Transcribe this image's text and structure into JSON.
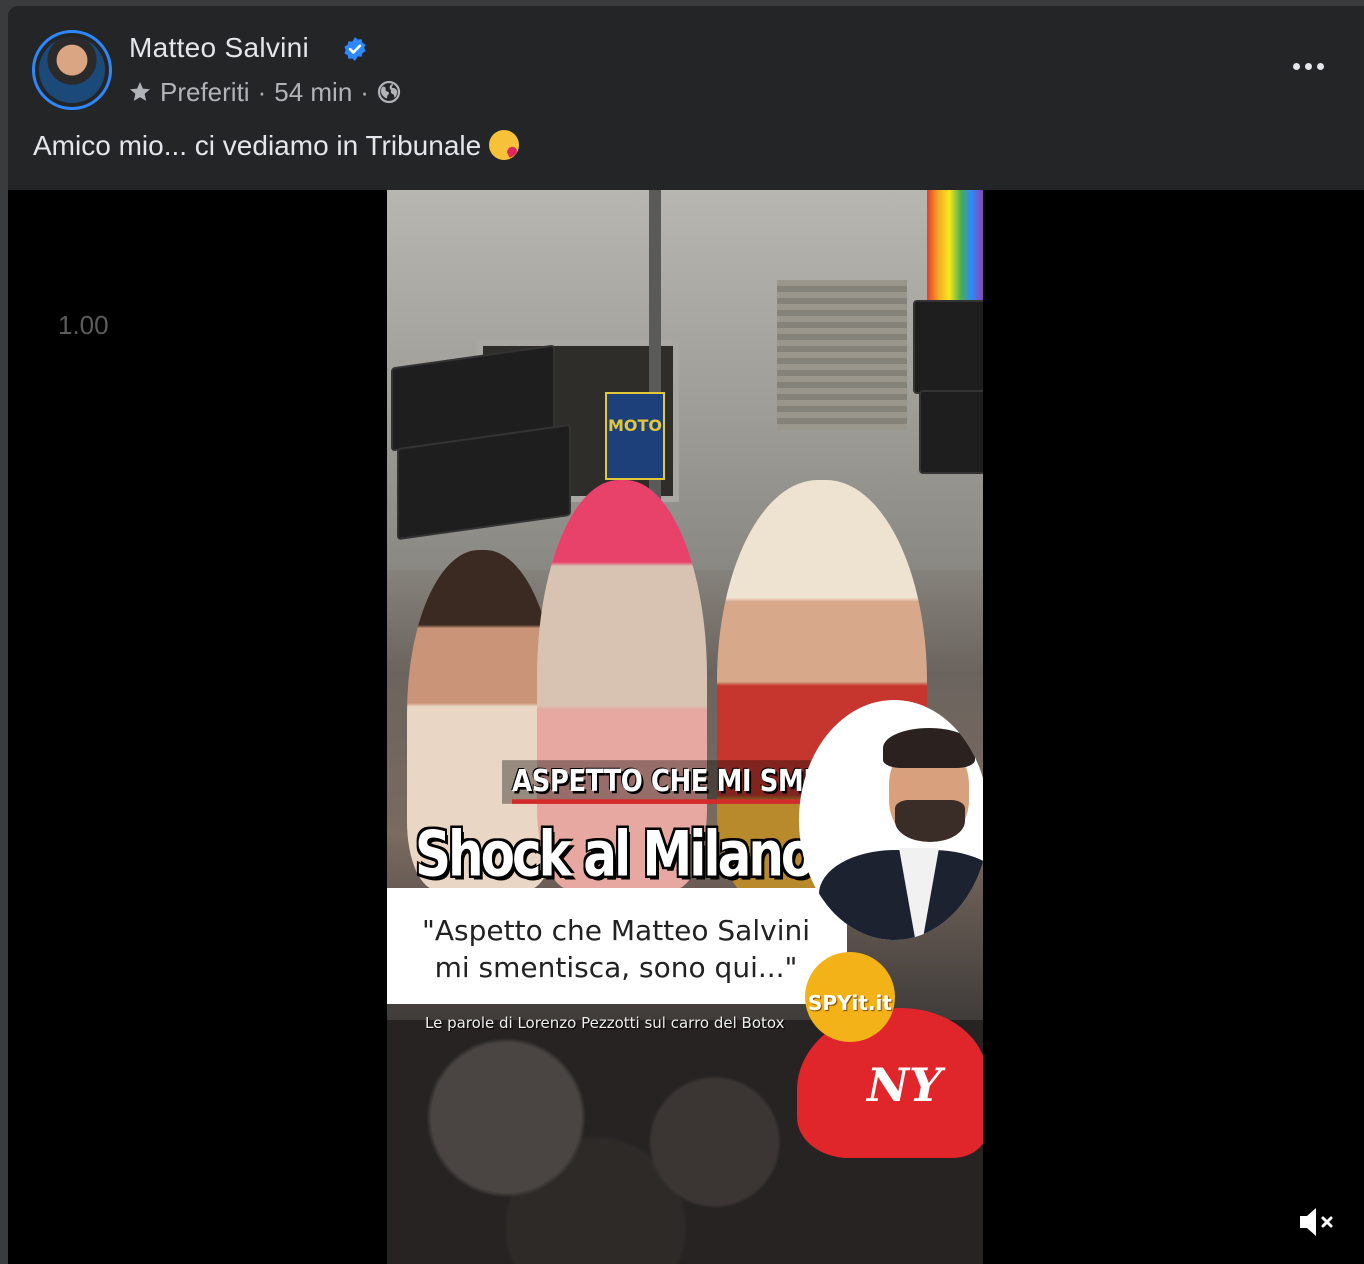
{
  "post": {
    "author": "Matteo Salvini",
    "verified": true,
    "audience_label": "Preferiti",
    "separator": "·",
    "time": "54 min",
    "caption": "Amico mio... ci vediamo in Tribunale",
    "caption_emoji": "kissing-face-emoji"
  },
  "video": {
    "speed": "1.00",
    "muted": true,
    "overlay": {
      "headline_small": "ASPETTO CHE MI SMENTISCA",
      "headline_big": "Shock al Milano Pride",
      "quote_line1": "\"Aspetto che Matteo Salvini",
      "quote_line2": "mi smentisca, sono qui...\"",
      "credit": "Le parole di Lorenzo Pezzotti sul carro del Botox",
      "logo_text": "SPYit.it",
      "sign_text": "MOTO",
      "cap_text": "NY"
    }
  },
  "colors": {
    "card_bg": "#242526",
    "page_bg": "#3a3b3c",
    "text_primary": "#e4e6eb",
    "text_secondary": "#b0b3b8",
    "verified_blue": "#2d88ff",
    "video_bg": "#000000"
  },
  "icons": [
    "verified-badge-icon",
    "star-icon",
    "globe-icon",
    "more-options-icon",
    "muted-speaker-icon"
  ]
}
